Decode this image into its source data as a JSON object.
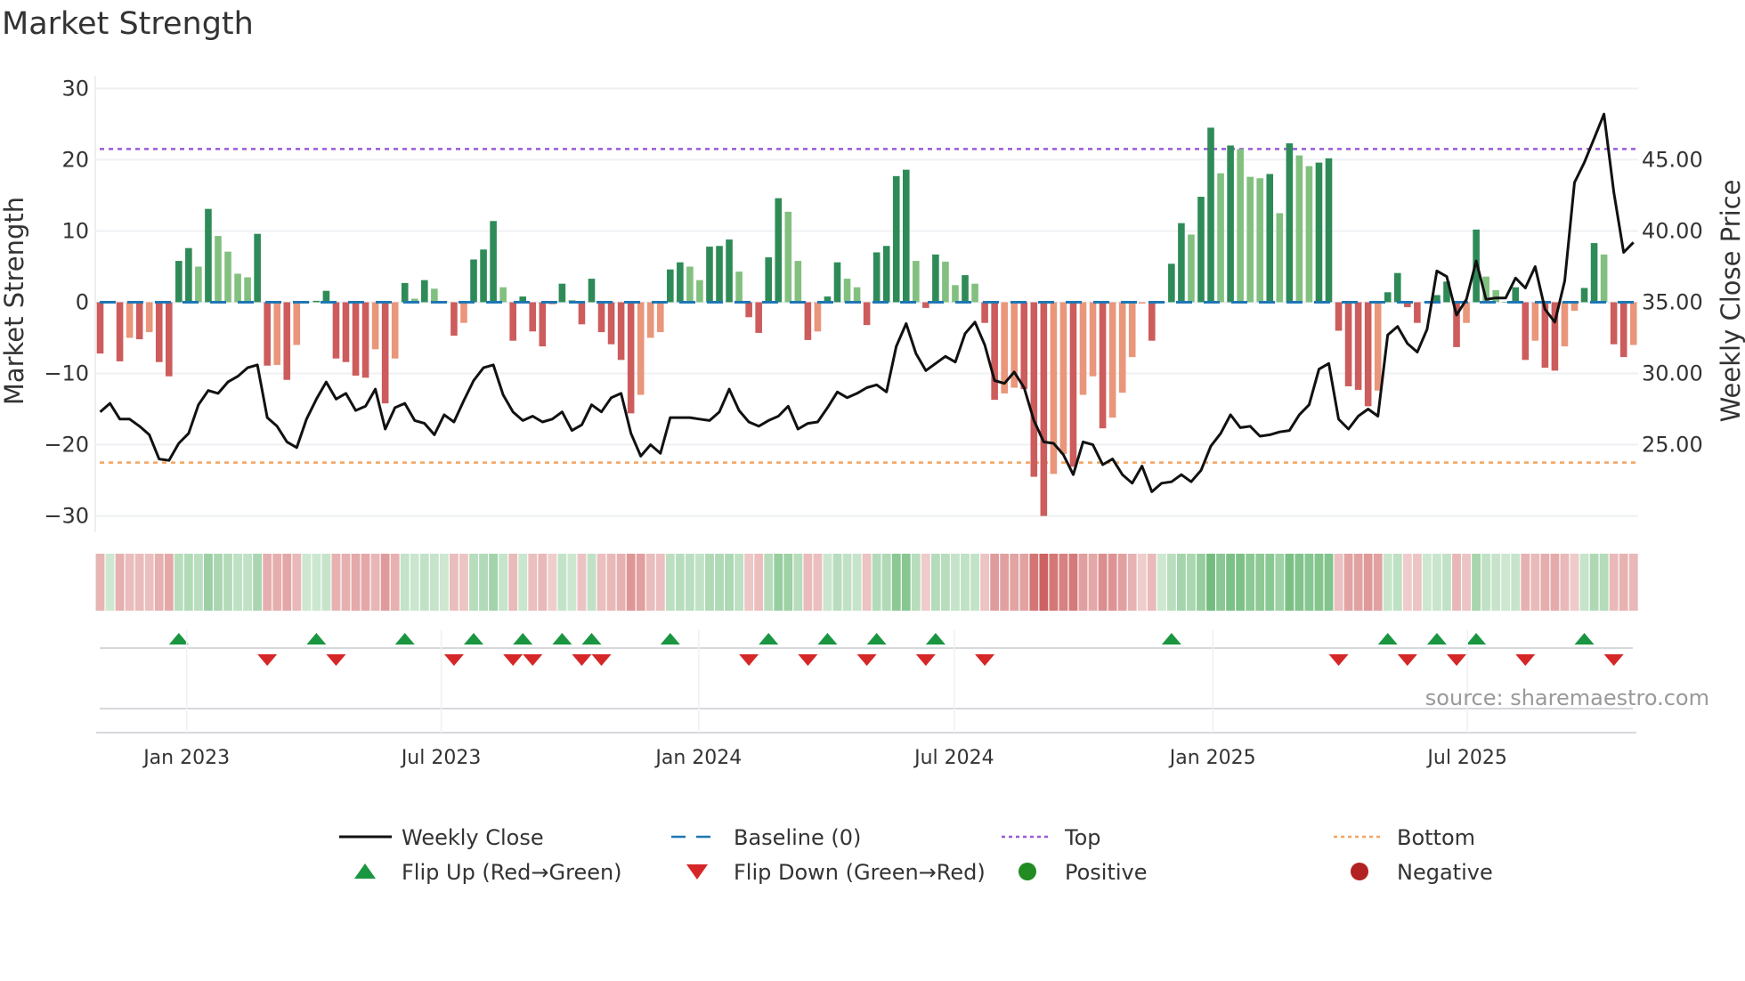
{
  "title": "Market Strength",
  "source": "source: sharemaestro.com",
  "colors": {
    "pos_strong": "#2e8b57",
    "pos_weak": "#82c07f",
    "neg_strong": "#cd5c5c",
    "neg_weak": "#e9967a",
    "close": "#111111",
    "baseline": "#1f77b4",
    "top": "#9b59d6",
    "bottom": "#f4a460",
    "flip_up": "#1a9641",
    "flip_down": "#d62728",
    "positive": "#228b22",
    "negative": "#b22222"
  },
  "chart_data": {
    "type": "bar",
    "title": "Market Strength",
    "ylabel": "Market Strength",
    "y2label": "Weekly Close Price",
    "ylim": [
      -32.3,
      31.8
    ],
    "y2lim": [
      18.85,
      50.9
    ],
    "yticks": [
      30,
      20,
      10,
      0,
      -10,
      -20,
      -30
    ],
    "ytick_labels": [
      "30",
      "20",
      "10",
      "0",
      "−10",
      "−20",
      "−30"
    ],
    "y2ticks": [
      45,
      40,
      35,
      30,
      25
    ],
    "y2tick_labels": [
      "45.00",
      "40.00",
      "35.00",
      "30.00",
      "25.00"
    ],
    "top_level": 21.5,
    "bottom_level": -22.5,
    "baseline": 0,
    "x_ticks": [
      {
        "label": "Jan 2023",
        "index": 8.8
      },
      {
        "label": "Jul 2023",
        "index": 34.7
      },
      {
        "label": "Jan 2024",
        "index": 60.9
      },
      {
        "label": "Jul 2024",
        "index": 86.9
      },
      {
        "label": "Jan 2025",
        "index": 113.2
      },
      {
        "label": "Jul 2025",
        "index": 139.1
      }
    ],
    "strength": [
      -7.2,
      0,
      -8.3,
      -5.0,
      -5.2,
      -4.2,
      -8.4,
      -10.4,
      5.8,
      7.6,
      5.0,
      13.1,
      9.3,
      7.1,
      4.0,
      3.5,
      9.6,
      -8.9,
      -8.8,
      -10.9,
      -6.0,
      0,
      0.2,
      1.6,
      -7.9,
      -8.4,
      -10.3,
      -10.6,
      -6.6,
      -14.2,
      -7.9,
      2.7,
      0.5,
      3.1,
      1.9,
      0.1,
      -4.7,
      -2.9,
      6.0,
      7.4,
      11.4,
      2.1,
      -5.4,
      0.8,
      -4.1,
      -6.2,
      -0.3,
      2.6,
      0.3,
      -3.1,
      3.3,
      -4.2,
      -5.9,
      -8.1,
      -15.6,
      -13.0,
      -5.0,
      -4.2,
      4.6,
      5.6,
      5.0,
      3.1,
      7.8,
      7.9,
      8.8,
      4.3,
      -2.1,
      -4.3,
      6.3,
      14.6,
      12.7,
      5.8,
      -5.3,
      -4.1,
      0.8,
      5.6,
      3.3,
      2.1,
      -3.2,
      7.0,
      7.9,
      17.7,
      18.6,
      5.8,
      -0.8,
      6.7,
      5.7,
      2.4,
      3.8,
      2.6,
      -2.9,
      -13.7,
      -12.8,
      -12.0,
      -12.2,
      -24.5,
      -30.0,
      -24.1,
      -21.3,
      -23.1,
      -13.0,
      -10.4,
      -17.7,
      -16.2,
      -12.7,
      -7.7,
      -0.2,
      -5.4,
      0,
      5.4,
      11.1,
      9.5,
      14.8,
      24.5,
      18.1,
      22.0,
      21.5,
      17.6,
      17.4,
      18.0,
      12.5,
      22.3,
      20.6,
      19.1,
      19.6,
      20.2,
      -4.0,
      -11.8,
      -12.3,
      -14.6,
      -12.4,
      1.4,
      4.1,
      -0.7,
      -2.9,
      0,
      1.0,
      2.9,
      -6.3,
      -2.9,
      10.2,
      3.6,
      1.7,
      0,
      2.1,
      -8.1,
      -5.4,
      -9.2,
      -9.6,
      -6.2,
      -1.2,
      2.0,
      8.3,
      6.7,
      -5.9,
      -7.7,
      -6.0
    ],
    "weekly_close": [
      27.3,
      27.9,
      26.8,
      26.8,
      26.3,
      25.7,
      24.0,
      23.9,
      25.1,
      25.8,
      27.8,
      28.8,
      28.6,
      29.4,
      29.8,
      30.4,
      30.6,
      26.9,
      26.3,
      25.2,
      24.8,
      26.8,
      28.2,
      29.4,
      28.2,
      28.6,
      27.4,
      27.7,
      28.9,
      26.1,
      27.6,
      27.9,
      26.7,
      26.5,
      25.7,
      27.1,
      26.6,
      28.1,
      29.5,
      30.4,
      30.6,
      28.5,
      27.3,
      26.7,
      27.0,
      26.6,
      26.8,
      27.3,
      26.0,
      26.4,
      27.8,
      27.3,
      28.3,
      28.6,
      25.8,
      24.2,
      25.0,
      24.4,
      26.9,
      26.9,
      26.9,
      26.8,
      26.7,
      27.3,
      28.9,
      27.4,
      26.6,
      26.3,
      26.7,
      27.0,
      27.7,
      26.1,
      26.5,
      26.6,
      27.6,
      28.7,
      28.3,
      28.6,
      29.0,
      29.2,
      28.7,
      31.9,
      33.5,
      31.4,
      30.2,
      30.7,
      31.2,
      30.8,
      32.8,
      33.6,
      32.0,
      29.5,
      29.3,
      30.1,
      29.0,
      26.7,
      25.2,
      25.1,
      24.3,
      22.9,
      25.2,
      25.0,
      23.6,
      24.0,
      22.9,
      22.3,
      23.5,
      21.7,
      22.3,
      22.4,
      22.9,
      22.4,
      23.2,
      24.9,
      25.8,
      27.1,
      26.2,
      26.3,
      25.6,
      25.7,
      25.9,
      26.0,
      27.1,
      27.8,
      30.3,
      30.7,
      26.8,
      26.1,
      27.0,
      27.5,
      27.0,
      32.7,
      33.3,
      32.1,
      31.5,
      33.1,
      37.2,
      36.8,
      34.1,
      35.2,
      37.9,
      35.2,
      35.3,
      35.3,
      36.7,
      36.0,
      37.5,
      34.5,
      33.6,
      36.5,
      43.4,
      44.8,
      46.5,
      48.2,
      42.7,
      38.5,
      39.2
    ],
    "legend": [
      {
        "label": "Weekly Close",
        "symbol": "line"
      },
      {
        "label": "Baseline (0)",
        "symbol": "dash"
      },
      {
        "label": "Top",
        "symbol": "dot-purple"
      },
      {
        "label": "Bottom",
        "symbol": "dot-orange"
      },
      {
        "label": "Flip Up (Red→Green)",
        "symbol": "triangle-up"
      },
      {
        "label": "Flip Down (Green→Red)",
        "symbol": "triangle-down"
      },
      {
        "label": "Positive",
        "symbol": "circle-green"
      },
      {
        "label": "Negative",
        "symbol": "circle-red"
      }
    ],
    "legend_position": "bottom"
  }
}
